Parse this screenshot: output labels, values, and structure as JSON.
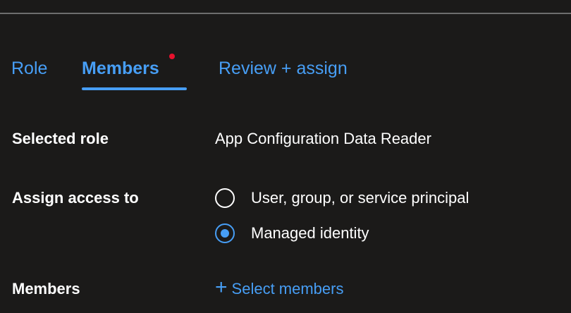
{
  "tabs": [
    {
      "label": "Role"
    },
    {
      "label": "Members"
    },
    {
      "label": "Review + assign"
    }
  ],
  "selected_role": {
    "label": "Selected role",
    "value": "App Configuration Data Reader"
  },
  "assign_access": {
    "label": "Assign access to",
    "options": [
      {
        "label": "User, group, or service principal",
        "checked": false
      },
      {
        "label": "Managed identity",
        "checked": true
      }
    ]
  },
  "members": {
    "label": "Members",
    "select_label": "Select members"
  },
  "colors": {
    "background": "#1b1a19",
    "accent": "#479ef5",
    "required_dot": "#e8112d"
  },
  "icons": {
    "add": "plus-icon",
    "required_indicator": "red-dot"
  }
}
